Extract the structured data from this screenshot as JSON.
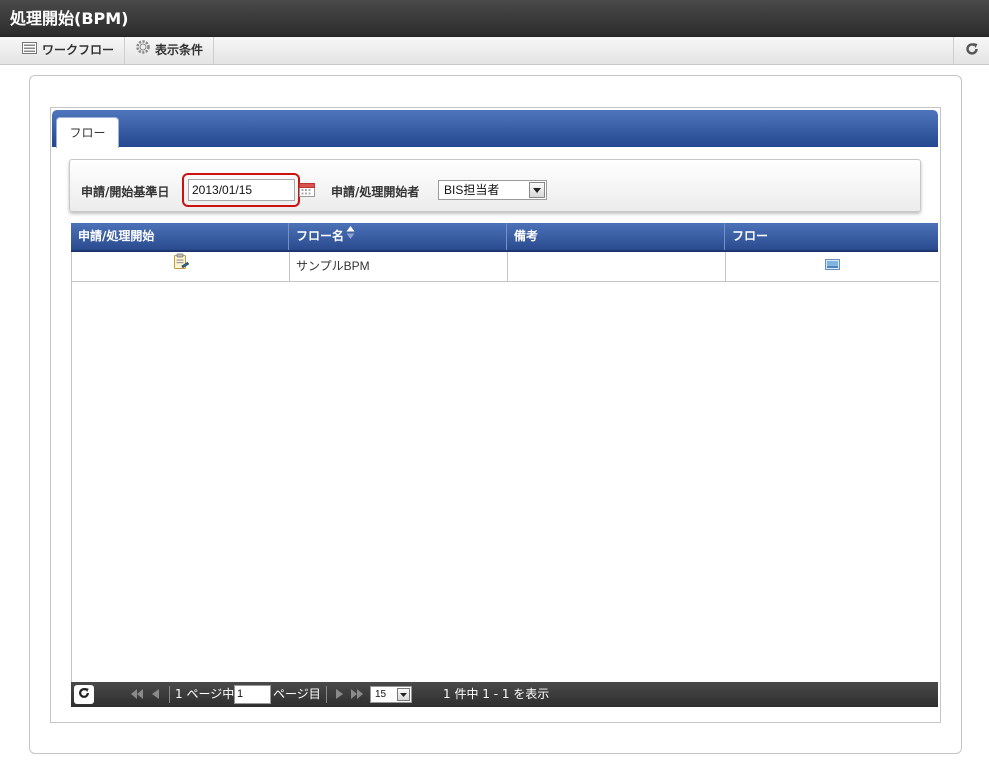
{
  "window": {
    "title": "処理開始(BPM)"
  },
  "toolbar": {
    "workflow_label": "ワークフロー",
    "display_conditions_label": "表示条件",
    "workflow_icon": "list-icon",
    "display_conditions_icon": "gear-icon",
    "refresh_icon": "refresh-icon"
  },
  "tabs": [
    {
      "label": "フロー",
      "active": true
    }
  ],
  "conditions": {
    "date_label": "申請/開始基準日",
    "date_value": "2013/01/15",
    "starter_label": "申請/処理開始者",
    "starter_value": "BIS担当者",
    "calendar_icon": "calendar-icon"
  },
  "grid": {
    "columns": [
      {
        "label": "申請/処理開始"
      },
      {
        "label": "フロー名",
        "sorted": "asc"
      },
      {
        "label": "備考"
      },
      {
        "label": "フロー"
      }
    ],
    "rows": [
      {
        "start_icon": "clipboard-icon",
        "flow_name": "サンプルBPM",
        "remarks": "",
        "flow_icon": "flow-image-icon"
      }
    ]
  },
  "pager": {
    "page_prefix": "1 ページ中",
    "page_value": "1",
    "page_suffix": "ページ目",
    "rows_per_page": "15",
    "summary": "1 件中 1 - 1 を表示"
  },
  "colors": {
    "accent_blue": "#2a4a8e",
    "highlight_red": "#cc1111",
    "titlebar": "#2b2b2b"
  }
}
